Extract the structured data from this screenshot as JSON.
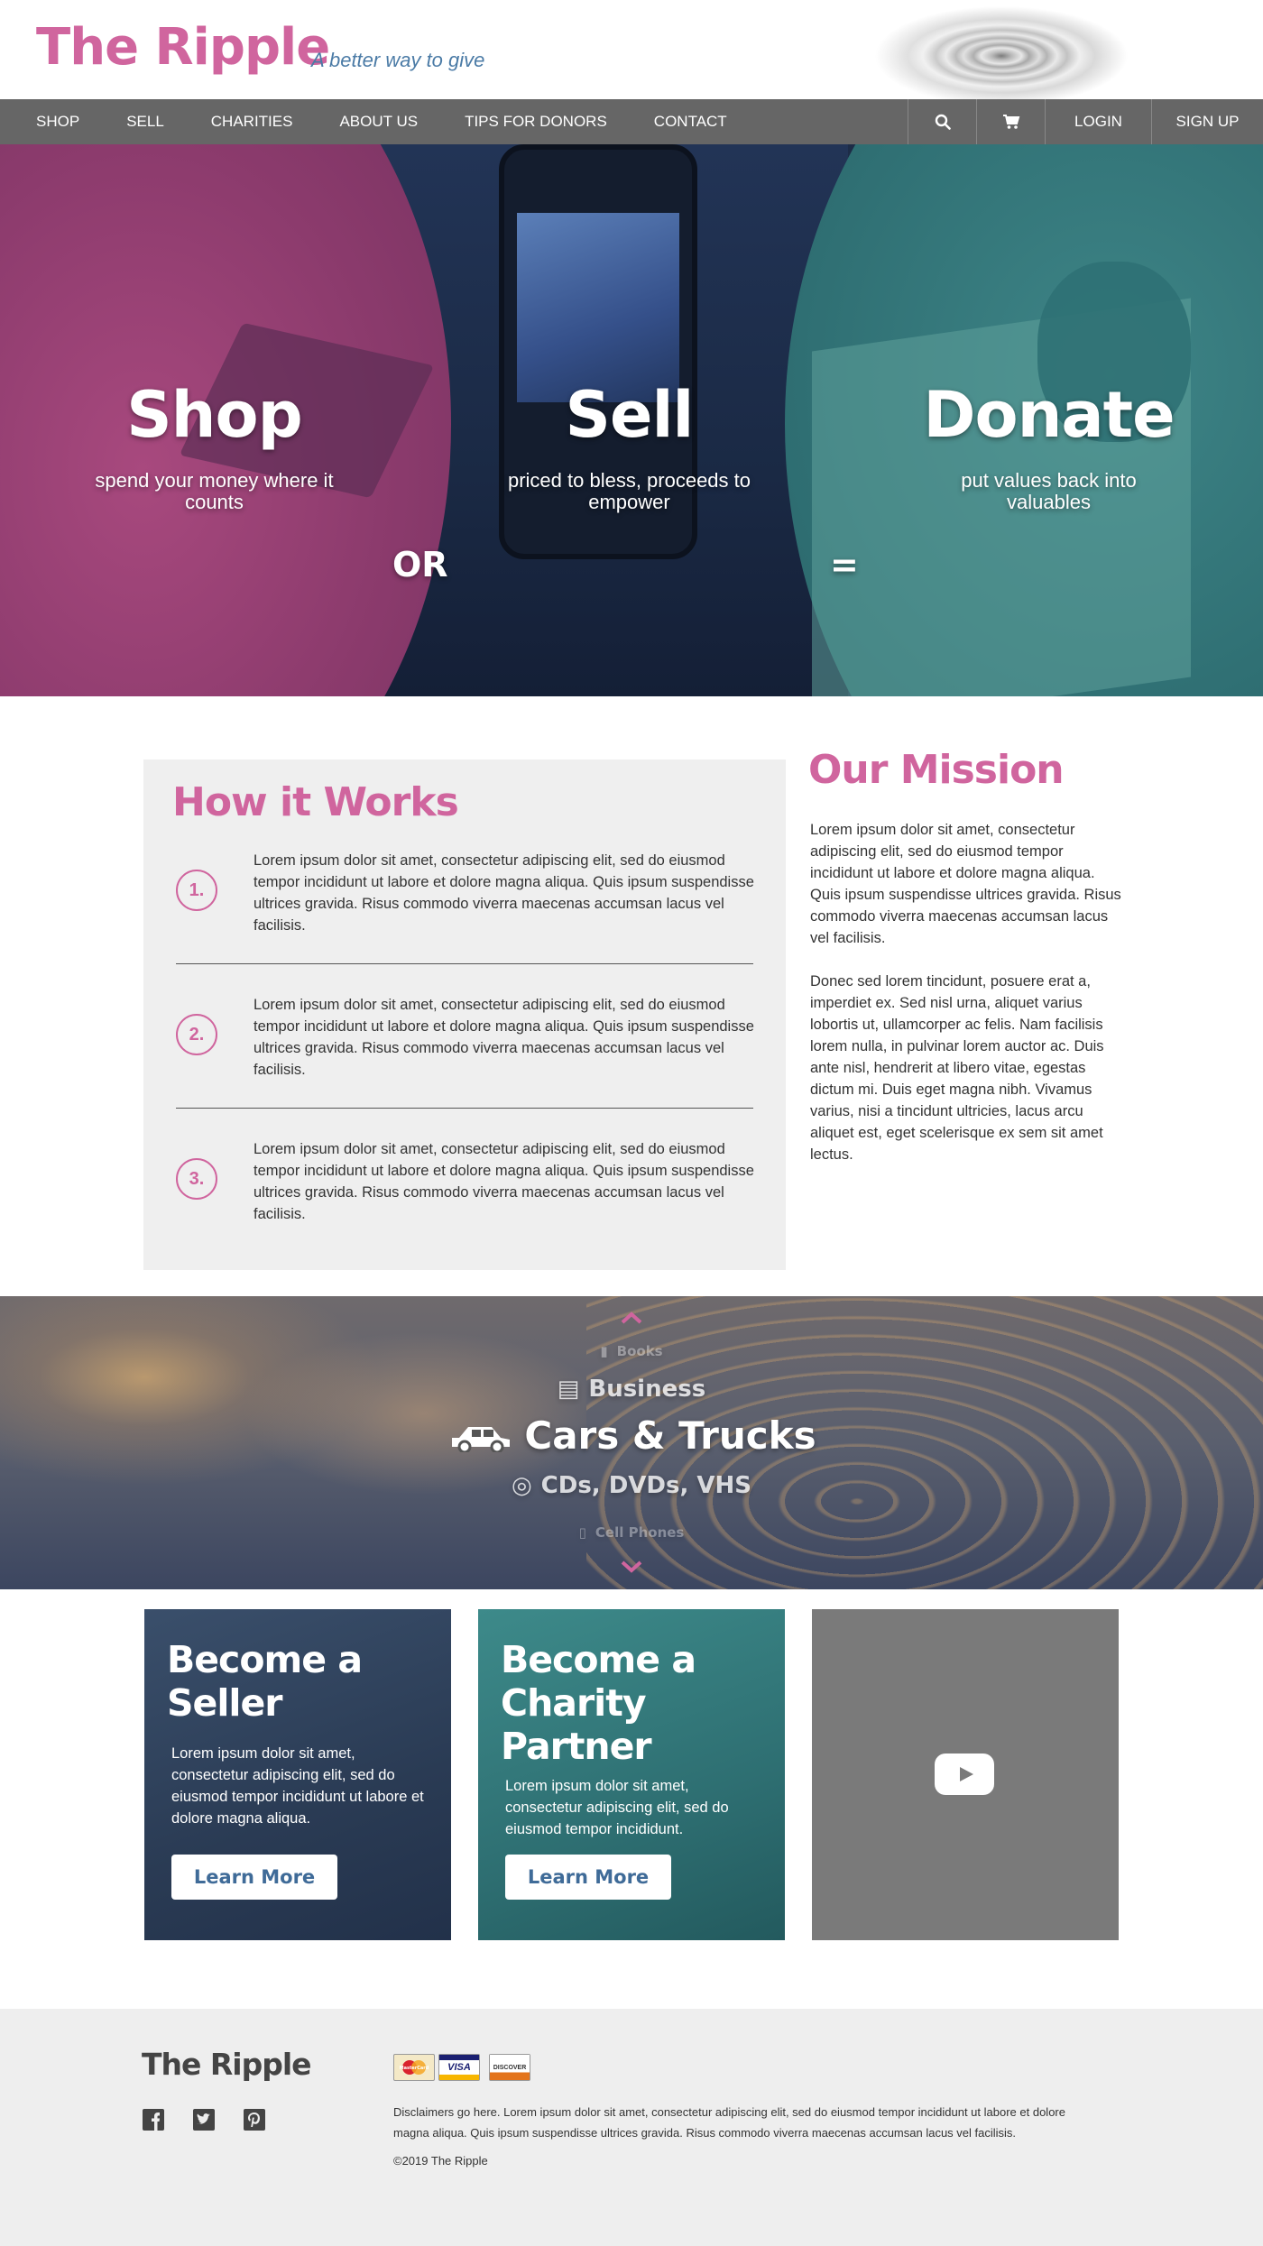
{
  "header": {
    "logo": "The Ripple",
    "tagline": "A better way to give"
  },
  "nav": {
    "links": [
      "SHOP",
      "SELL",
      "CHARITIES",
      "ABOUT US",
      "TIPS FOR DONORS",
      "CONTACT"
    ],
    "search_icon": "search-icon",
    "cart_icon": "cart-icon",
    "login": "LOGIN",
    "signup": "SIGN UP"
  },
  "hero": {
    "shop_title": "Shop",
    "shop_sub": "spend your money where it counts",
    "or": "OR",
    "sell_title": "Sell",
    "sell_sub": "priced to bless, proceeds to empower",
    "equals": "=",
    "donate_title": "Donate",
    "donate_sub": "put values back into valuables"
  },
  "how": {
    "title": "How it Works",
    "steps": [
      {
        "num": "1.",
        "text": "Lorem ipsum dolor sit amet, consectetur adipiscing elit, sed do eiusmod tempor incididunt ut labore et dolore magna aliqua. Quis ipsum suspendisse ultrices gravida. Risus commodo viverra maecenas accumsan lacus vel facilisis."
      },
      {
        "num": "2.",
        "text": "Lorem ipsum dolor sit amet, consectetur adipiscing elit, sed do eiusmod tempor incididunt ut labore et dolore magna aliqua. Quis ipsum suspendisse ultrices gravida. Risus commodo viverra maecenas accumsan lacus vel facilisis."
      },
      {
        "num": "3.",
        "text": "Lorem ipsum dolor sit amet, consectetur adipiscing elit, sed do eiusmod tempor incididunt ut labore et dolore magna aliqua. Quis ipsum suspendisse ultrices gravida. Risus commodo viverra maecenas accumsan lacus vel facilisis."
      }
    ]
  },
  "mission": {
    "title": "Our Mission",
    "p1": "Lorem ipsum dolor sit amet, consectetur adipiscing elit, sed do eiusmod tempor incididunt ut labore et dolore magna aliqua. Quis ipsum suspendisse ultrices gravida. Risus commodo viverra maecenas accumsan lacus vel facilisis.",
    "p2": "Donec sed lorem tincidunt, posuere erat a, imperdiet ex. Sed nisl urna, aliquet varius lobortis ut, ullamcorper ac felis. Nam facilisis lorem nulla, in pulvinar lorem auctor ac. Duis ante nisl, hendrerit at libero vitae, egestas dictum mi. Duis eget magna nibh. Vivamus varius, nisi a tincidunt ultricies, lacus arcu aliquet est, eget scelerisque ex sem sit amet lectus."
  },
  "categories": {
    "items": [
      {
        "label": "Books",
        "icon": "book-icon"
      },
      {
        "label": "Business",
        "icon": "building-icon"
      },
      {
        "label": "Cars & Trucks",
        "icon": "car-icon"
      },
      {
        "label": "CDs, DVDs, VHS",
        "icon": "disc-icon"
      },
      {
        "label": "Cell Phones",
        "icon": "phone-icon"
      }
    ]
  },
  "cards": {
    "seller": {
      "title": "Become a Seller",
      "text": "Lorem ipsum dolor sit amet, consectetur adipiscing elit, sed do eiusmod tempor incididunt ut labore et dolore magna aliqua.",
      "button": "Learn More"
    },
    "partner": {
      "title": "Become a Charity Partner",
      "text": "Lorem ipsum dolor sit amet, consectetur adipiscing elit, sed do eiusmod tempor incididunt.",
      "button": "Learn More"
    },
    "video": {
      "icon": "youtube-play-icon"
    }
  },
  "footer": {
    "logo": "The Ripple",
    "social": [
      "facebook-icon",
      "twitter-icon",
      "pinterest-icon"
    ],
    "payments": [
      "MasterCard",
      "VISA",
      "DISCOVER"
    ],
    "disclaimer": "Disclaimers go here. Lorem ipsum dolor sit amet, consectetur adipiscing elit, sed do eiusmod tempor incididunt ut labore et dolore magna aliqua. Quis ipsum suspendisse ultrices gravida. Risus commodo viverra maecenas accumsan lacus vel facilisis.",
    "copyright": "©2019 The Ripple"
  },
  "colors": {
    "brand_pink": "#d0659e",
    "tagline_blue": "#4b7ba6",
    "nav_gray": "#666666",
    "footer_gray": "#eeeeee"
  }
}
